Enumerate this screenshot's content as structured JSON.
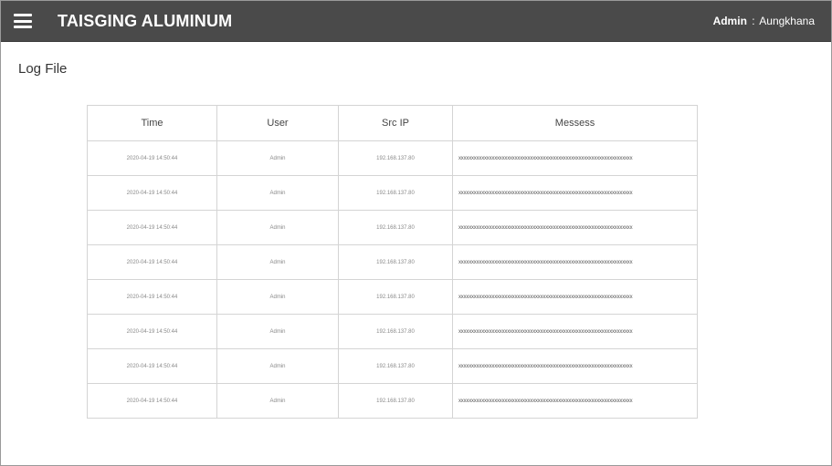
{
  "header": {
    "app_title": "TAISGING ALUMINUM",
    "user_role": "Admin",
    "user_separator": ":",
    "user_name": "Aungkhana"
  },
  "page": {
    "title": "Log File"
  },
  "table": {
    "columns": [
      "Time",
      "User",
      "Src IP",
      "Messess"
    ],
    "rows": [
      {
        "time": "2020-04-19 14:50:44",
        "user": "Admin",
        "src_ip": "192.168.137.80",
        "message": "xxxxxxxxxxxxxxxxxxxxxxxxxxxxxxxxxxxxxxxxxxxxxxxxxxxxxxxxxxxxxxxxxxxx"
      },
      {
        "time": "2020-04-19 14:50:44",
        "user": "Admin",
        "src_ip": "192.168.137.80",
        "message": "xxxxxxxxxxxxxxxxxxxxxxxxxxxxxxxxxxxxxxxxxxxxxxxxxxxxxxxxxxxxxxxxxxxx"
      },
      {
        "time": "2020-04-19 14:50:44",
        "user": "Admin",
        "src_ip": "192.168.137.80",
        "message": "xxxxxxxxxxxxxxxxxxxxxxxxxxxxxxxxxxxxxxxxxxxxxxxxxxxxxxxxxxxxxxxxxxxx"
      },
      {
        "time": "2020-04-19 14:50:44",
        "user": "Admin",
        "src_ip": "192.168.137.80",
        "message": "xxxxxxxxxxxxxxxxxxxxxxxxxxxxxxxxxxxxxxxxxxxxxxxxxxxxxxxxxxxxxxxxxxxx"
      },
      {
        "time": "2020-04-19 14:50:44",
        "user": "Admin",
        "src_ip": "192.168.137.80",
        "message": "xxxxxxxxxxxxxxxxxxxxxxxxxxxxxxxxxxxxxxxxxxxxxxxxxxxxxxxxxxxxxxxxxxxx"
      },
      {
        "time": "2020-04-19 14:50:44",
        "user": "Admin",
        "src_ip": "192.168.137.80",
        "message": "xxxxxxxxxxxxxxxxxxxxxxxxxxxxxxxxxxxxxxxxxxxxxxxxxxxxxxxxxxxxxxxxxxxx"
      },
      {
        "time": "2020-04-19 14:50:44",
        "user": "Admin",
        "src_ip": "192.168.137.80",
        "message": "xxxxxxxxxxxxxxxxxxxxxxxxxxxxxxxxxxxxxxxxxxxxxxxxxxxxxxxxxxxxxxxxxxxx"
      },
      {
        "time": "2020-04-19 14:50:44",
        "user": "Admin",
        "src_ip": "192.168.137.80",
        "message": "xxxxxxxxxxxxxxxxxxxxxxxxxxxxxxxxxxxxxxxxxxxxxxxxxxxxxxxxxxxxxxxxxxxx"
      }
    ]
  },
  "icons": {
    "menu": "hamburger-menu-icon"
  },
  "colors": {
    "header_bg": "#4a4a4a",
    "header_text": "#ffffff",
    "table_border": "#d4d4d4"
  }
}
